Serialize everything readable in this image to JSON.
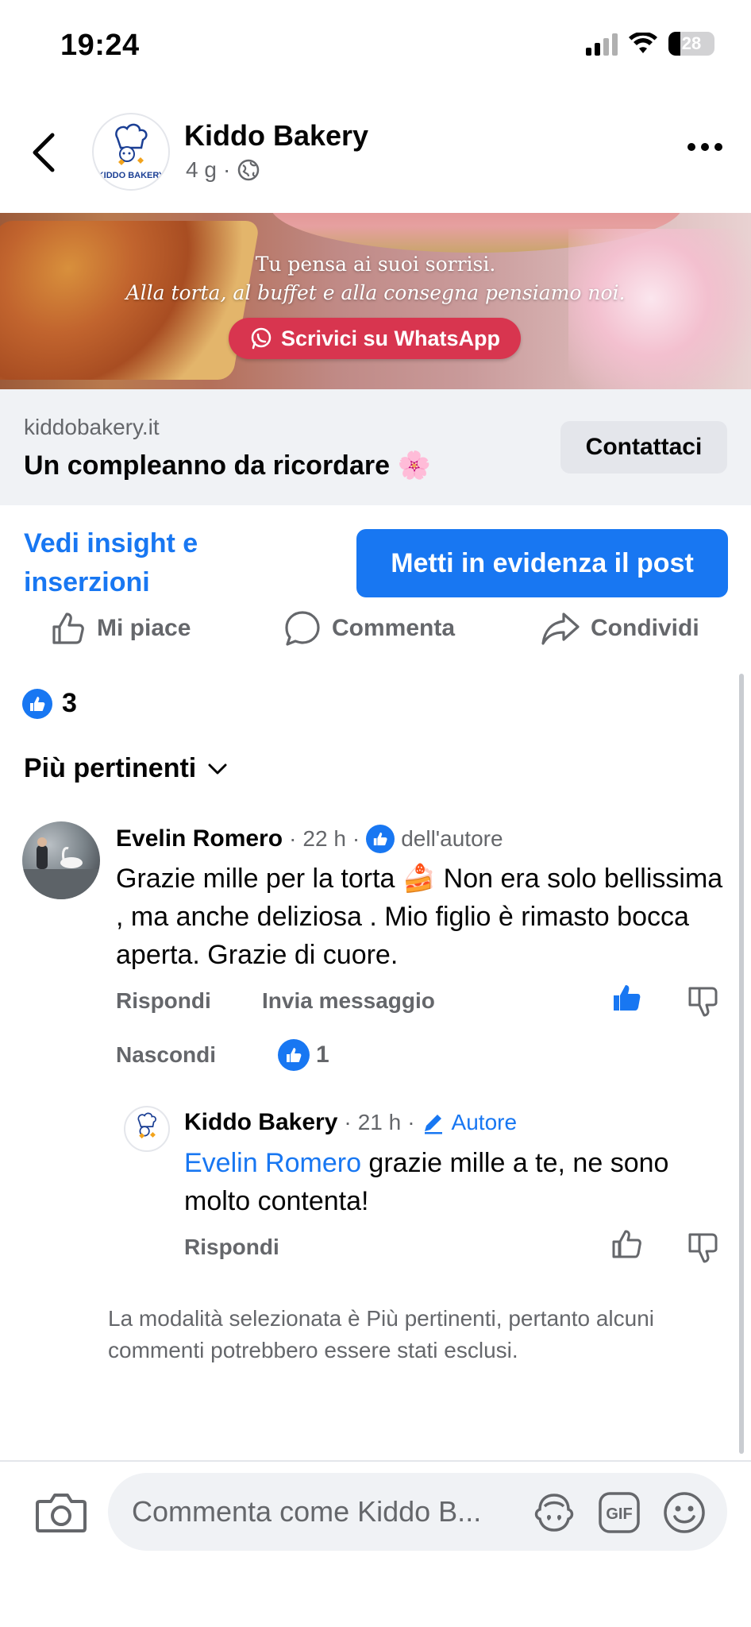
{
  "status_bar": {
    "time": "19:24",
    "battery": "28"
  },
  "header": {
    "page_name": "Kiddo Bakery",
    "meta_time": "4 g",
    "meta_separator": "·",
    "avatar_text": "KIDDO BAKERY"
  },
  "banner": {
    "line1": "Tu pensa ai suoi sorrisi.",
    "line2": "Alla torta, al buffet e alla consegna pensiamo noi.",
    "whatsapp_label": "Scrivici su WhatsApp"
  },
  "link_card": {
    "domain": "kiddobakery.it",
    "title": "Un compleanno da ricordare 🌸",
    "contact_label": "Contattaci"
  },
  "insights_label": "Vedi insight e inserzioni",
  "boost_label": "Metti in evidenza il post",
  "actions": {
    "like": "Mi piace",
    "comment": "Commenta",
    "share": "Condividi"
  },
  "reactions_count": "3",
  "sort_label": "Più pertinenti",
  "comment1": {
    "author": "Evelin Romero",
    "time": "22 h",
    "author_badge": "dell'autore",
    "text": "Grazie mille per la torta 🍰 Non era solo bellissima , ma anche deliziosa . Mio figlio è rimasto bocca aperta. Grazie di cuore.",
    "reply_label": "Rispondi",
    "message_label": "Invia messaggio",
    "hide_label": "Nascondi",
    "like_count": "1"
  },
  "reply1": {
    "author": "Kiddo Bakery",
    "time": "21 h",
    "author_badge": "Autore",
    "mention": "Evelin Romero",
    "text": " grazie mille a te, ne sono molto contenta!",
    "reply_label": "Rispondi"
  },
  "notice": "La modalità selezionata è Più pertinenti, pertanto alcuni commenti potrebbero essere stati esclusi.",
  "composer": {
    "placeholder": "Commenta come Kiddo B..."
  },
  "colors": {
    "accent": "#1877f2",
    "secondary_text": "#65676b",
    "whatsapp_button": "#d8354f"
  },
  "icons": [
    "back-icon",
    "more-icon",
    "globe-icon",
    "whatsapp-icon",
    "like-icon",
    "comment-icon",
    "share-icon",
    "chevron-down-icon",
    "thumbs-up-icon",
    "thumbs-down-icon",
    "pencil-icon",
    "camera-icon",
    "avatar-sticker-icon",
    "gif-icon",
    "emoji-icon"
  ]
}
